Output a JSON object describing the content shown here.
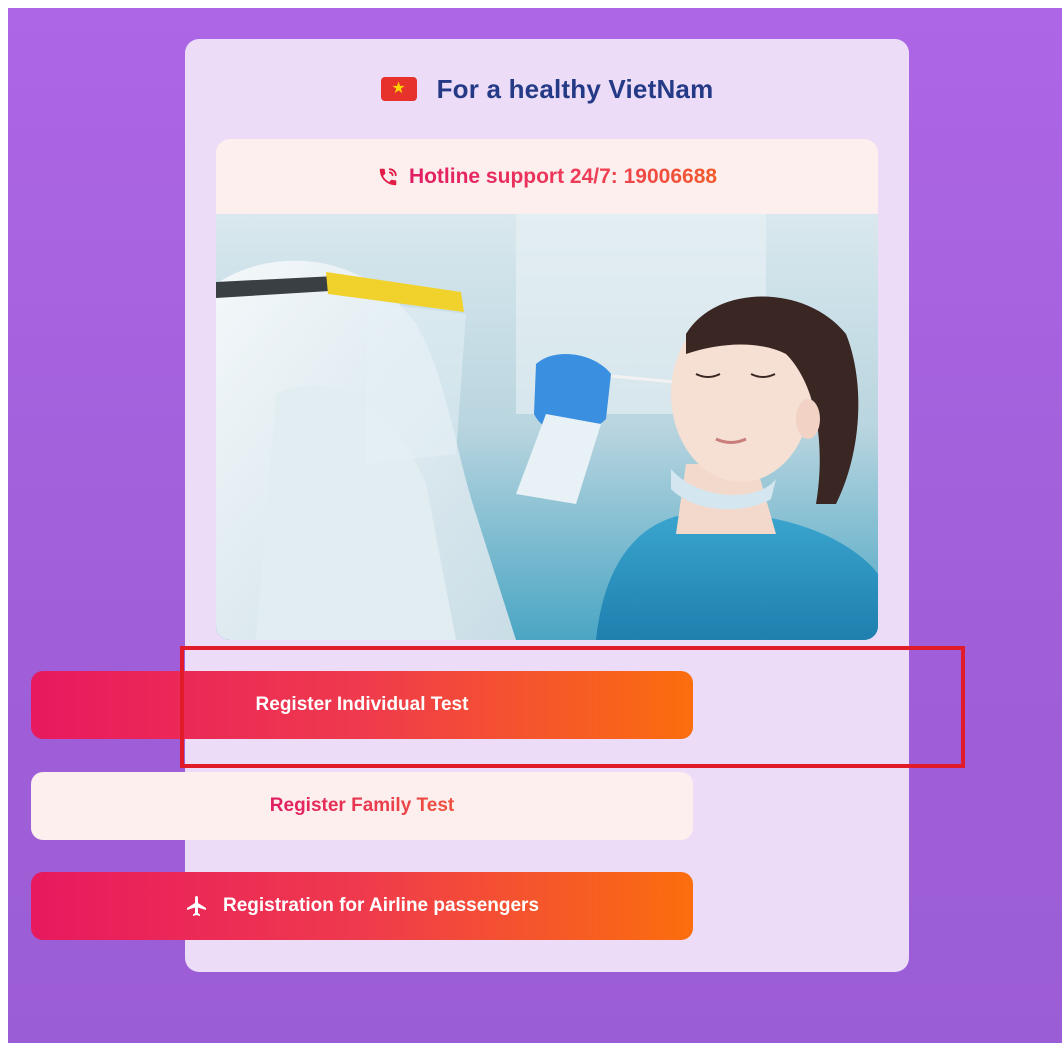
{
  "header": {
    "title": "For a healthy VietNam",
    "flag_icon": "vietnam-flag-icon"
  },
  "hotline": {
    "label": "Hotline support 24/7: 19006688",
    "icon": "phone-icon"
  },
  "hero": {
    "icon": "covid-swab-test-photo"
  },
  "buttons": {
    "individual": "Register Individual Test",
    "family": "Register Family Test",
    "airline": "Registration for Airline passengers",
    "airline_icon": "airplane-icon"
  },
  "colors": {
    "background": "#a85fe0",
    "card": "#ecdcf7",
    "title": "#253a86",
    "accent_start": "#e8195f",
    "accent_end": "#fb6e0d",
    "highlight": "#e21b2a"
  }
}
